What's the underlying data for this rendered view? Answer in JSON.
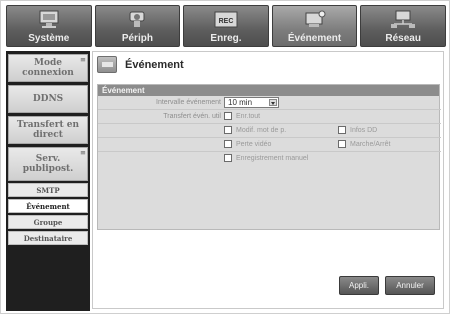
{
  "tabs": [
    {
      "label": "Système",
      "icon": "system-monitor-icon"
    },
    {
      "label": "Périph",
      "icon": "camera-device-icon"
    },
    {
      "label": "Enreg.",
      "icon": "rec-icon",
      "icon_text": "REC"
    },
    {
      "label": "Événement",
      "icon": "event-icon"
    },
    {
      "label": "Réseau",
      "icon": "network-icon"
    }
  ],
  "sidebar": {
    "items": [
      {
        "label": "Mode connexion"
      },
      {
        "label": "DDNS"
      },
      {
        "label": "Transfert en direct"
      },
      {
        "label": "Serv. publipost."
      }
    ],
    "subitems": [
      {
        "label": "SMTP"
      },
      {
        "label": "Événement"
      },
      {
        "label": "Groupe"
      },
      {
        "label": "Destinataire"
      }
    ]
  },
  "content": {
    "title": "Événement",
    "panel_title": "Événement",
    "interval_label": "Intervalle événement",
    "interval_value": "10 min",
    "transfer_label": "Transfert évén. util",
    "checkboxes": {
      "all": "Enr.tout",
      "password_change": "Modif. mot de p.",
      "hdd_info": "Infos DD",
      "video_loss": "Perte vidéo",
      "start_stop": "Marche/Arrêt",
      "manual_rec": "Enregistrement manuel"
    }
  },
  "buttons": {
    "apply": "Appli.",
    "cancel": "Annuler"
  }
}
